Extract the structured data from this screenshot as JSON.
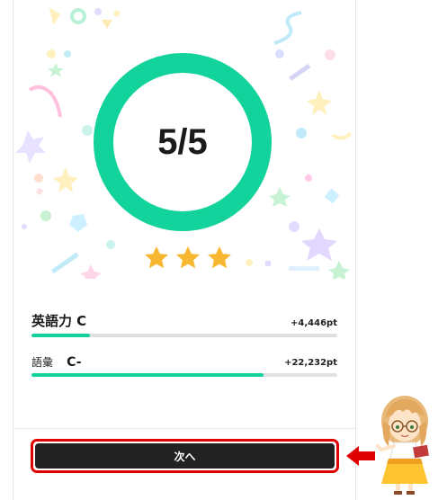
{
  "result": {
    "score_text": "5/5",
    "progress_ring_fraction": 1.0,
    "accent_color": "#12d39b",
    "stars_earned": 3,
    "stars_total": 3,
    "star_color": "#f7b731"
  },
  "skills": [
    {
      "name": "英語力",
      "grade": "C",
      "points": "+4,446pt",
      "progress": 0.19
    },
    {
      "name": "語彙",
      "grade": "C-",
      "points": "+22,232pt",
      "progress": 0.76
    }
  ],
  "footer": {
    "next_label": "次へ",
    "highlight_color": "#e00000"
  },
  "icons": [
    "star-icon",
    "arrow-left-icon",
    "guide-character-image"
  ]
}
